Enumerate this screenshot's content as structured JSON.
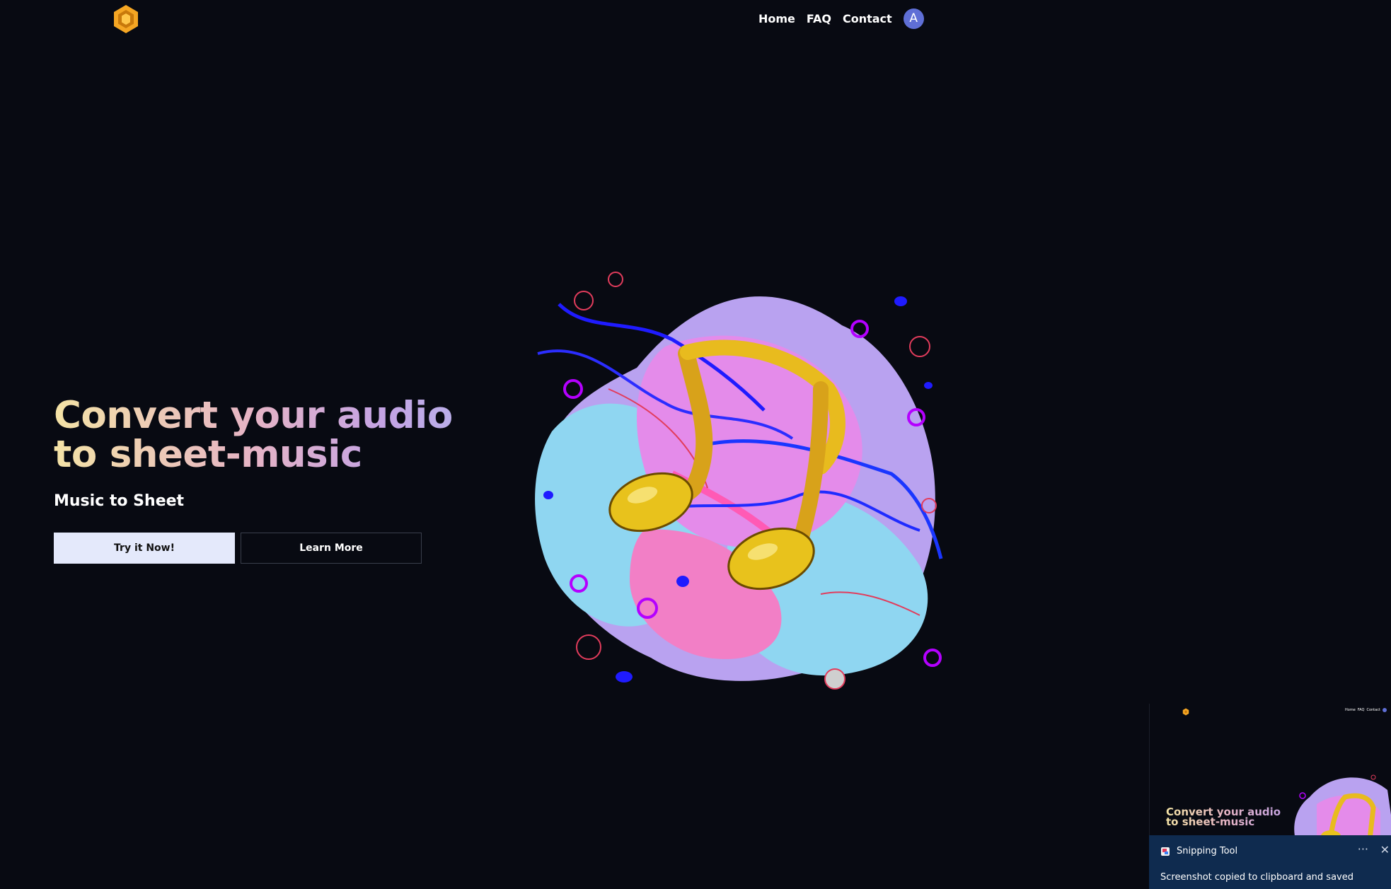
{
  "nav": {
    "logo_icon": "hexagon-logo-icon",
    "links": [
      "Home",
      "FAQ",
      "Contact"
    ],
    "avatar_initial": "A"
  },
  "hero": {
    "title": "Convert your audio to sheet-music",
    "subtitle": "Music to Sheet",
    "primary_button": "Try it Now!",
    "secondary_button": "Learn More",
    "image_icon": "music-note-illustration"
  },
  "colors": {
    "background": "#080a12",
    "logo_orange": "#f5a623",
    "avatar": "#5f6fd6",
    "primary_button": "#e4e9fb",
    "toast_background": "#0f2b4f"
  },
  "toast": {
    "app_name": "Snipping Tool",
    "message": "Screenshot copied to clipboard and saved",
    "more_label": "···",
    "close_label": "✕",
    "preview": {
      "links": [
        "Home",
        "FAQ",
        "Contact"
      ],
      "title": "Convert your audio to sheet-music"
    }
  }
}
